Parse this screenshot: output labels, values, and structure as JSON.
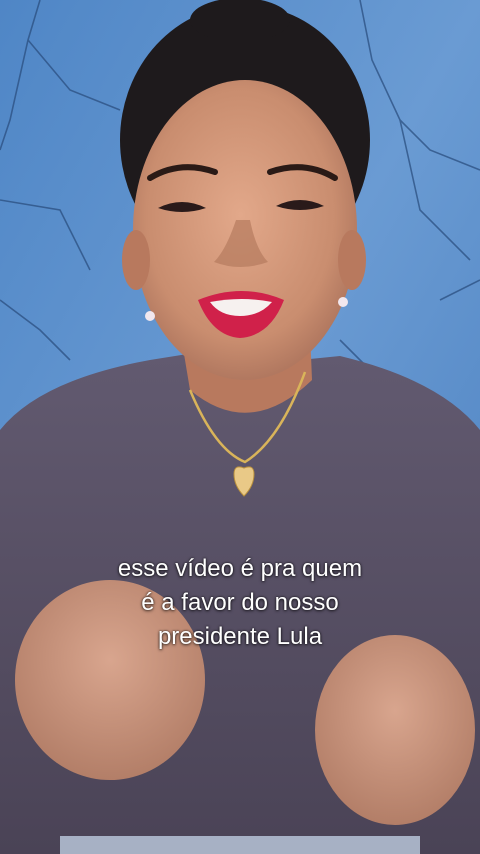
{
  "caption": {
    "lines": [
      "esse vídeo é pra quem",
      "é a favor do nosso",
      "presidente Lula"
    ],
    "color": "#ffffff"
  },
  "colors": {
    "background_wall": "#5b8ec9",
    "shirt": "#5a5266",
    "skin": "#c98d6f",
    "hair": "#1e1a1c",
    "lips": "#d0214a"
  }
}
